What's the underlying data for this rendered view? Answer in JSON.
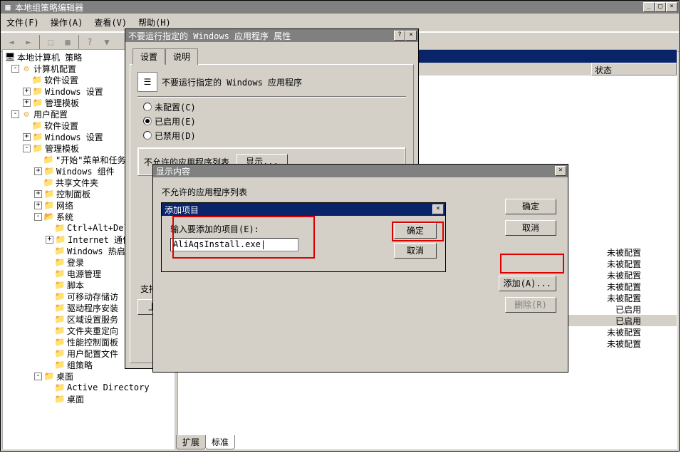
{
  "main": {
    "title": "本地组策略编辑器",
    "menu": {
      "file": "文件(F)",
      "action": "操作(A)",
      "view": "查看(V)",
      "help": "帮助(H)"
    }
  },
  "tree": {
    "root": "本地计算机 策略",
    "computer_cfg": "计算机配置",
    "software_settings": "软件设置",
    "windows_settings": "Windows 设置",
    "admin_templates": "管理模板",
    "user_cfg": "用户配置",
    "start_menu": "\"开始\"菜单和任务栏",
    "windows_components": "Windows 组件",
    "shared_folders": "共享文件夹",
    "control_panel": "控制面板",
    "network": "网络",
    "system": "系统",
    "ctrl_alt_del": "Ctrl+Alt+Del",
    "internet_comm": "Internet 通信",
    "windows_hot": "Windows 热启",
    "logon": "登录",
    "power_mgmt": "电源管理",
    "scripts": "脚本",
    "removable_storage": "可移动存储访",
    "driver_install": "驱动程序安装",
    "locale_services": "区域设置服务",
    "folder_redirect": "文件夹重定向",
    "perf_control": "性能控制面板",
    "user_profile": "用户配置文件",
    "group_policy": "组策略",
    "desktop": "桌面",
    "active_directory": "Active Directory",
    "desktop2": "桌面"
  },
  "list": {
    "header_status": "状态",
    "rows": [
      {
        "status": "未被配置"
      },
      {
        "status": "未被配置"
      },
      {
        "status": "未被配置"
      },
      {
        "status": "未被配置"
      },
      {
        "status": "未被配置"
      },
      {
        "status": "已启用"
      },
      {
        "status": "已启用",
        "selected": true
      },
      {
        "status": "未被配置"
      },
      {
        "status": "未被配置"
      }
    ],
    "tab_ext": "扩展",
    "tab_std": "标准"
  },
  "props": {
    "title": "不要运行指定的 Windows 应用程序 属性",
    "tab_settings": "设置",
    "tab_explain": "说明",
    "policy_name": "不要运行指定的 Windows 应用程序",
    "radio_notcfg": "未配置(C)",
    "radio_enabled": "已启用(E)",
    "radio_disabled": "已禁用(D)",
    "disallow_list_label": "不允许的应用程序列表",
    "show_btn": "显示...",
    "supported_on_label": "支持于:",
    "prev_btn": "上一设置(P)"
  },
  "showdlg": {
    "title": "显示内容",
    "label": "不允许的应用程序列表",
    "ok": "确定",
    "cancel": "取消",
    "add": "添加(A)...",
    "remove": "删除(R)"
  },
  "adddlg": {
    "title": "添加项目",
    "label": "输入要添加的项目(E):",
    "value": "AliAqsInstall.exe",
    "ok": "确定",
    "cancel": "取消"
  }
}
